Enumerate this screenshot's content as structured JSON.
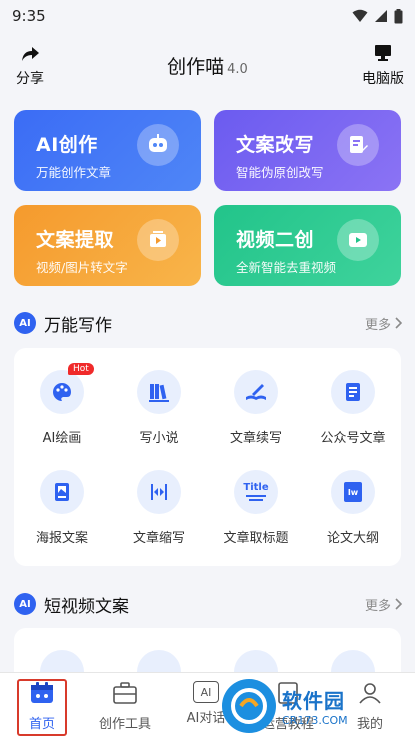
{
  "status": {
    "time": "9:35"
  },
  "header": {
    "share_label": "分享",
    "title": "创作喵",
    "version": "4.0",
    "desktop_label": "电脑版"
  },
  "features": [
    {
      "title": "AI创作",
      "subtitle": "万能创作文章",
      "icon": "robot-icon"
    },
    {
      "title": "文案改写",
      "subtitle": "智能伪原创改写",
      "icon": "edit-doc-icon"
    },
    {
      "title": "文案提取",
      "subtitle": "视频/图片转文字",
      "icon": "video-extract-icon"
    },
    {
      "title": "视频二创",
      "subtitle": "全新智能去重视频",
      "icon": "video-remix-icon"
    }
  ],
  "section1": {
    "badge": "AI",
    "title": "万能写作",
    "more": "更多",
    "tools": [
      {
        "label": "AI绘画",
        "icon": "palette-icon",
        "hot": "Hot"
      },
      {
        "label": "写小说",
        "icon": "books-icon"
      },
      {
        "label": "文章续写",
        "icon": "book-pen-icon"
      },
      {
        "label": "公众号文章",
        "icon": "article-icon"
      },
      {
        "label": "海报文案",
        "icon": "poster-icon"
      },
      {
        "label": "文章缩写",
        "icon": "compress-icon"
      },
      {
        "label": "文章取标题",
        "icon": "title-icon",
        "icon_text": "Title"
      },
      {
        "label": "论文大纲",
        "icon": "thesis-icon",
        "icon_text": "Iw"
      }
    ]
  },
  "section2": {
    "badge": "AI",
    "title": "短视频文案",
    "more": "更多"
  },
  "tabbar": {
    "items": [
      {
        "label": "首页",
        "icon": "home-calendar-icon"
      },
      {
        "label": "创作工具",
        "icon": "toolbox-icon"
      },
      {
        "label": "AI对话",
        "icon": "ai-chat-icon",
        "icon_text": "AI"
      },
      {
        "label": "运营教程",
        "icon": "tutorial-icon"
      },
      {
        "label": "我的",
        "icon": "profile-icon"
      }
    ]
  },
  "watermark": {
    "big": "软件园",
    "small": "CR173.COM"
  },
  "colors": {
    "primary": "#2f62f0",
    "hot": "#f02a2a",
    "frame": "#d83a2b"
  }
}
